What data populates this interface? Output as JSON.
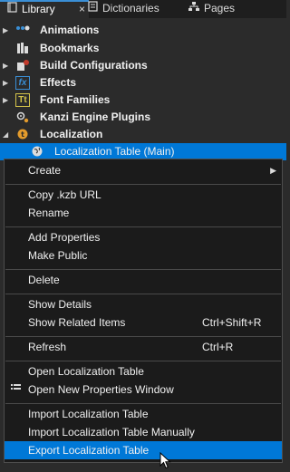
{
  "tabs": [
    {
      "label": "Library",
      "icon": "book-icon",
      "active": true
    },
    {
      "label": "Dictionaries",
      "icon": "dictionary-icon",
      "active": false
    },
    {
      "label": "Pages",
      "icon": "pages-icon",
      "active": false
    }
  ],
  "tab_close": "×",
  "tree": [
    {
      "label": "Animations",
      "icon": "animation-icon"
    },
    {
      "label": "Bookmarks",
      "icon": "bookmark-icon"
    },
    {
      "label": "Build Configurations",
      "icon": "build-config-icon"
    },
    {
      "label": "Effects",
      "icon": "effects-icon",
      "icon_text": "fx"
    },
    {
      "label": "Font Families",
      "icon": "font-icon",
      "icon_text": "Tt"
    },
    {
      "label": "Kanzi Engine Plugins",
      "icon": "plugin-icon"
    },
    {
      "label": "Localization",
      "icon": "localization-icon"
    },
    {
      "label": "Localization Table (Main)",
      "icon": "globe-icon",
      "selected": true
    }
  ],
  "menu": {
    "create": "Create",
    "copy_url": "Copy .kzb URL",
    "rename": "Rename",
    "add_properties": "Add Properties",
    "make_public": "Make Public",
    "delete": "Delete",
    "show_details": "Show Details",
    "show_related": "Show Related Items",
    "show_related_shortcut": "Ctrl+Shift+R",
    "refresh": "Refresh",
    "refresh_shortcut": "Ctrl+R",
    "open_table": "Open Localization Table",
    "open_props": "Open New Properties Window",
    "import_table": "Import Localization Table",
    "import_manual": "Import Localization Table Manually",
    "export_table": "Export Localization Table"
  },
  "colors": {
    "accent": "#0078d7",
    "background": "#2b2b2b",
    "menu_background": "#1b1b1b",
    "text": "#f0f0f0"
  }
}
